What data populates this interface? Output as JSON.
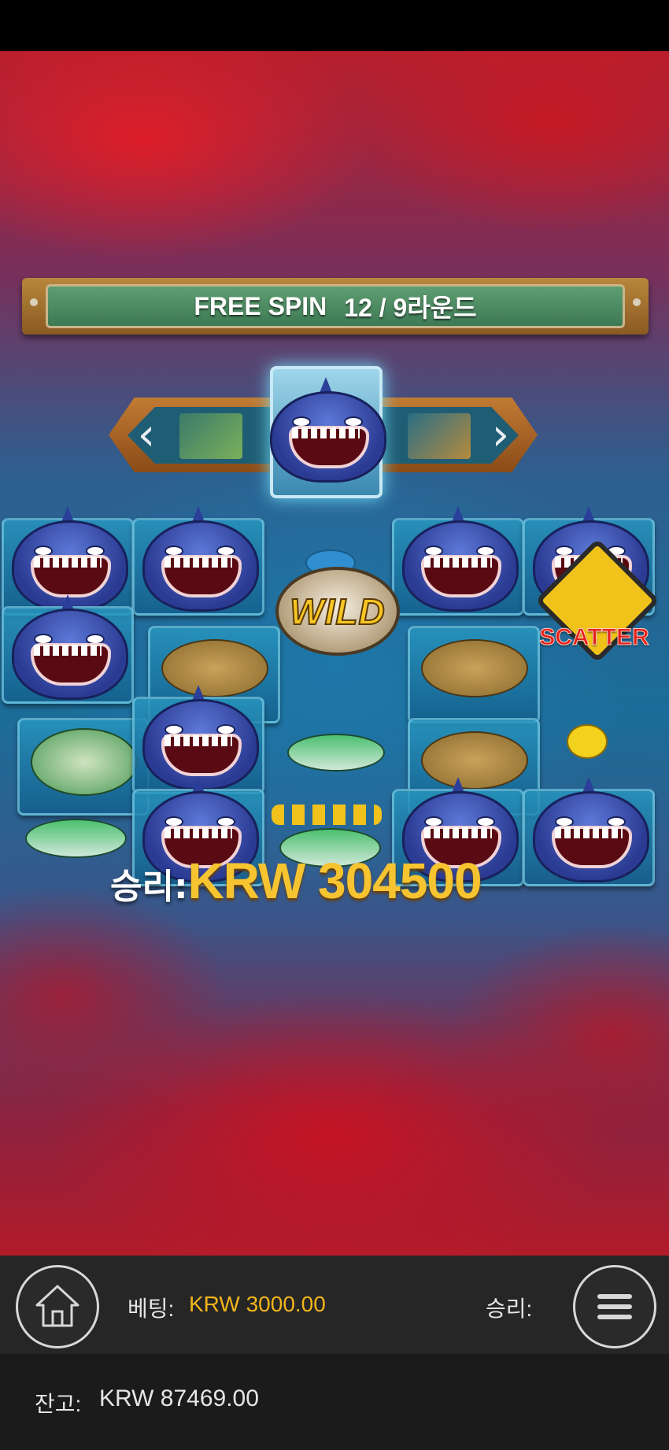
{
  "banner": {
    "free_spin": "FREE SPIN",
    "round": "12 / 9라운드"
  },
  "symbols": {
    "wild": "WILD",
    "scatter": "SCATTER"
  },
  "win": {
    "label": "승리:",
    "amount": "KRW 304500"
  },
  "bottom": {
    "home_icon": "home-icon",
    "menu_icon": "menu-icon",
    "bet_label": "베팅:",
    "bet_value": "KRW 3000.00",
    "win_label": "승리:",
    "balance_label": "잔고:",
    "balance_value": "KRW 87469.00"
  },
  "colors": {
    "accent": "#f2b51b",
    "win_gold": "#f6c431",
    "banner_green": "#4d8b63"
  }
}
